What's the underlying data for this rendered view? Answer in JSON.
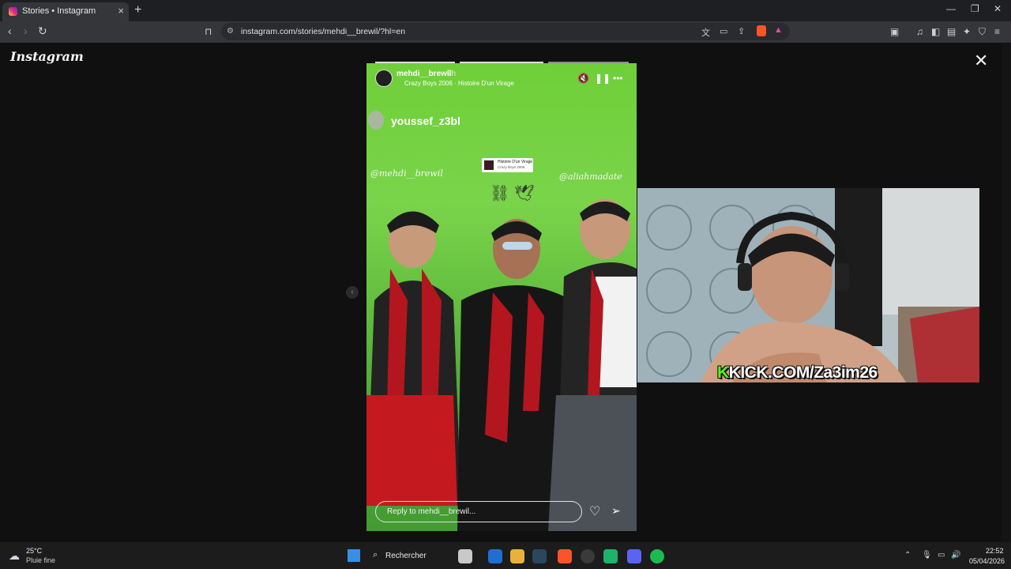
{
  "browser": {
    "tab_title": "Stories • Instagram",
    "url": "instagram.com/stories/mehdi__brewil/?hl=en"
  },
  "instagram": {
    "logo": "Instagram"
  },
  "story": {
    "username": "mehdi__brewil",
    "time": "2h",
    "song": "Crazy Boys 2006 · Histoire D'un Virage",
    "mention": "youssef_z3bl",
    "music_card_title": "Histoire D'un Virage",
    "music_card_artist": "Crazy Boys 2006",
    "tag_left": "@mehdi__brewil",
    "tag_right": "@aliahmadate",
    "reply_placeholder": "Reply to mehdi__brewil..."
  },
  "overlay": {
    "kick_letter": "K",
    "kick_text": "KICK.COM/Za3im26",
    "kick_color": "#53fc18"
  },
  "taskbar": {
    "temperature": "25°C",
    "weather": "Pluie fine",
    "search": "Rechercher",
    "time": "22:52",
    "date": "05/04/2026"
  }
}
